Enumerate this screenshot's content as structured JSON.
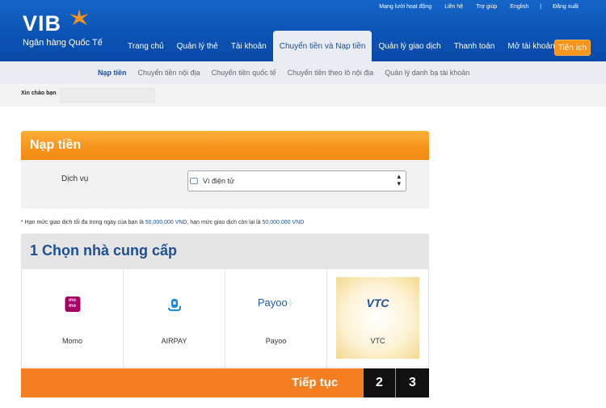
{
  "brand": {
    "name": "VIB",
    "tagline": "Ngân hàng Quốc Tế",
    "star_color": "#f7941d"
  },
  "top_links": [
    "Mạng lưới hoạt động",
    "Liên hệ",
    "Trợ giúp",
    "English",
    "|",
    "Đăng xuất"
  ],
  "main_nav": {
    "items": [
      "Trang chủ",
      "Quản lý thẻ",
      "Tài khoản",
      "Chuyển tiền và Nạp tiền",
      "Quản lý giao dịch",
      "Thanh toán",
      "Mở tài khoản"
    ],
    "active_index": 3,
    "utility_button": "Tiện ích"
  },
  "sub_nav": {
    "items": [
      "Nạp tiền",
      "Chuyển tiền nội địa",
      "Chuyển tiền quốc tế",
      "Chuyển tiền theo lô nội địa",
      "Quản lý danh bạ tài khoản"
    ],
    "active_index": 0
  },
  "greeting": {
    "text": "Xin chào bạn"
  },
  "topup": {
    "title": "Nạp tiền",
    "service_label": "Dịch vụ",
    "service_value": "Ví điện tử"
  },
  "limit_note": {
    "prefix": "* Hạn mức giao dịch tối đa trong ngày của bạn là",
    "daily_limit": "50,000,000 VND",
    "middle": ", hạn mức giao dịch còn lại là",
    "remaining_limit": "50,000,000 VND"
  },
  "providers": {
    "title": "1 Chọn nhà cung cấp",
    "items": [
      {
        "name": "Momo",
        "icon": "momo-logo-icon",
        "logo_text": "mo mo"
      },
      {
        "name": "AIRPAY",
        "icon": "airpay-logo-icon"
      },
      {
        "name": "Payoo",
        "icon": "payoo-logo-icon",
        "logo_text": "Payoo"
      },
      {
        "name": "VTC",
        "icon": "vtc-logo-icon",
        "logo_text": "VTC"
      }
    ],
    "selected_index": 3
  },
  "footer": {
    "next_label": "Tiếp tục",
    "steps": [
      "2",
      "3"
    ]
  },
  "colors": {
    "header_blue": "#0b52b3",
    "orange": "#f7941d",
    "link_blue": "#1d4f96",
    "step_black": "#111111"
  }
}
